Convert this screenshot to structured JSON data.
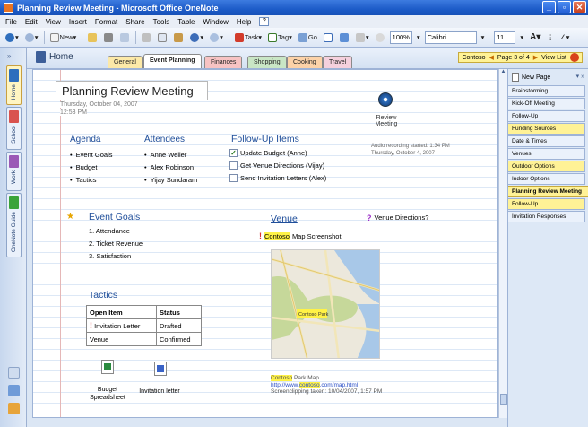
{
  "window": {
    "title": "Planning Review Meeting - Microsoft Office OneNote",
    "min": "_",
    "max": "▫",
    "close": "✕"
  },
  "menu": [
    "File",
    "Edit",
    "View",
    "Insert",
    "Format",
    "Share",
    "Tools",
    "Table",
    "Window",
    "Help"
  ],
  "toolbar": {
    "new_label": "New",
    "task_label": "Task",
    "tag_label": "Tag",
    "go_label": "Go",
    "zoom": "100%",
    "font": "Calibri",
    "size": "11"
  },
  "notebooks": [
    {
      "label": "Home",
      "color": "#2e6ebd"
    },
    {
      "label": "School",
      "color": "#d9534f"
    },
    {
      "label": "Work",
      "color": "#9b59b6"
    },
    {
      "label": "OneNote Guide",
      "color": "#3aa33a"
    }
  ],
  "breadcrumb": {
    "home": "Home"
  },
  "sections": [
    {
      "label": "General",
      "color": "#fce9a8"
    },
    {
      "label": "Event Planning",
      "color": "#ffffff"
    },
    {
      "label": "Finances",
      "color": "#f7c3c3"
    },
    {
      "label": "Shopping",
      "color": "#c9e6c5"
    },
    {
      "label": "Cooking",
      "color": "#fcd2a8"
    },
    {
      "label": "Travel",
      "color": "#f5d0dd"
    }
  ],
  "pager": {
    "notebook": "Contoso",
    "page_info": "Page 3 of 4",
    "view_list": "View List"
  },
  "page": {
    "title": "Planning Review Meeting",
    "date": "Thursday, October 04, 2007",
    "time": "12:53 PM",
    "agenda_title": "Agenda",
    "agenda": [
      "Event Goals",
      "Budget",
      "Tactics"
    ],
    "attendees_title": "Attendees",
    "attendees": [
      "Anne Weiler",
      "Alex Robinson",
      "Yijay Sundaram"
    ],
    "followup_title": "Follow-Up Items",
    "followups": [
      {
        "label": "Update Budget (Anne)",
        "checked": "✓"
      },
      {
        "label": "Get Venue Directions (Vijay)",
        "checked": ""
      },
      {
        "label": "Send Invitation Letters (Alex)",
        "checked": ""
      }
    ],
    "audio_label": "Review Meeting",
    "audio_meta_1": "Audio recording started: 1:34 PM",
    "audio_meta_2": "Thursday, October 4, 2007",
    "goals_title": "Event Goals",
    "goals": [
      "1.  Attendance",
      "2.  Ticket Revenue",
      "3.  Satisfaction"
    ],
    "venue_title": "Venue",
    "venue_question": "Venue Directions?",
    "map_prefix": "Contoso",
    "map_suffix": "Map Screenshot:",
    "map_park_label": "Contoso Park",
    "caption_brand": "Contoso",
    "caption_rest": "Park Map",
    "caption_url_prefix": "http://www.",
    "caption_url_brand": "contoso",
    "caption_url_suffix": ".com/map.html",
    "caption_taken": "Screenclipping taken: 10/04/2007, 1:57 PM",
    "tactics_title": "Tactics",
    "table_headers": [
      "Open Item",
      "Status"
    ],
    "table_rows": [
      {
        "item": "Invitation Letter",
        "status": "Drafted"
      },
      {
        "item": "Venue",
        "status": "Confirmed"
      }
    ],
    "attachments": [
      "Budget Spreadsheet",
      "Invitation letter"
    ]
  },
  "pagelist": {
    "new_page": "New Page",
    "items": [
      {
        "label": "Brainstorming",
        "style": "normal"
      },
      {
        "label": "Kick-Off Meeting",
        "style": "normal"
      },
      {
        "label": "Follow-Up",
        "style": "normal"
      },
      {
        "label": "Funding Sources",
        "style": "yellow"
      },
      {
        "label": "Date & Times",
        "style": "normal"
      },
      {
        "label": "Venues",
        "style": "normal"
      },
      {
        "label": "Outdoor Options",
        "style": "yellow"
      },
      {
        "label": "Indoor Options",
        "style": "normal"
      },
      {
        "label": "Planning Review Meeting",
        "style": "active"
      },
      {
        "label": "Follow-Up",
        "style": "yellow"
      },
      {
        "label": "Invitation Responses",
        "style": "normal"
      }
    ]
  }
}
